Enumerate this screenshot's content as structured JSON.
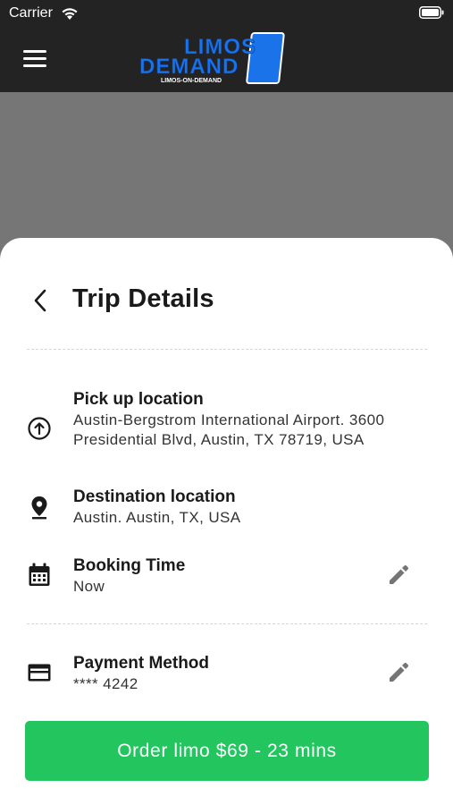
{
  "status_bar": {
    "carrier": "Carrier"
  },
  "header": {
    "logo": {
      "line1": "LIMOS",
      "line2": "DEMAND",
      "tagline": "LIMOS-ON-DEMAND"
    }
  },
  "trip": {
    "title": "Trip Details",
    "pickup": {
      "label": "Pick up location",
      "value": "Austin-Bergstrom International Airport. 3600 Presidential Blvd, Austin, TX 78719, USA",
      "icon": "arrow-up-circle-icon"
    },
    "destination": {
      "label": "Destination location",
      "value": "Austin. Austin, TX, USA",
      "icon": "location-pin-icon"
    },
    "booking": {
      "label": "Booking Time",
      "value": "Now",
      "icon": "calendar-icon"
    },
    "payment": {
      "label": "Payment Method",
      "value": "**** 4242",
      "icon": "credit-card-icon"
    }
  },
  "order_button": {
    "label": "Order limo $69 - 23 mins"
  },
  "colors": {
    "header_bg": "#222322",
    "map_bg": "#767676",
    "logo_blue": "#1a73e8",
    "accent_green": "#22c55e",
    "icon_gray": "#757575"
  }
}
